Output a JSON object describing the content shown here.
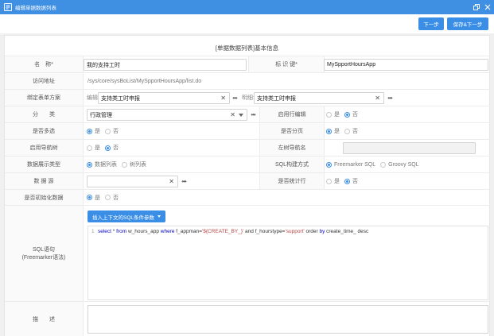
{
  "window": {
    "title": "编辑单据数据列表"
  },
  "toolbar": {
    "next_label": "下一步",
    "save_next_label": "保存&下一步"
  },
  "panel": {
    "title": "[单据数据列表]基本信息"
  },
  "form": {
    "name": {
      "label": "名　称*",
      "value": "我的支持工时"
    },
    "identifier": {
      "label": "标 识 键*",
      "value": "MySpportHoursApp"
    },
    "url": {
      "label": "访问地址",
      "value": "/sys/core/sysBoList/MySpportHoursApp/list.do"
    },
    "bind_form": {
      "label": "绑定表单方案",
      "edit_label": "编辑:",
      "edit_value": "支持类工时申报",
      "detail_label": "明细:",
      "detail_value": "支持类工时申报"
    },
    "category": {
      "label": "分　　类",
      "value": "行政管理"
    },
    "row_edit": {
      "label": "启用行编辑",
      "options": [
        "是",
        "否"
      ],
      "selected": "否"
    },
    "multi_select": {
      "label": "是否多选",
      "options": [
        "是",
        "否"
      ],
      "selected": "是"
    },
    "paging": {
      "label": "是否分页",
      "options": [
        "是",
        "否"
      ],
      "selected": "是"
    },
    "nav_tree": {
      "label": "启用导航树",
      "options": [
        "是",
        "否"
      ],
      "selected": "否"
    },
    "left_nav_name": {
      "label": "左树导航名",
      "value": ""
    },
    "display_type": {
      "label": "数据展示类型",
      "options": [
        "数据列表",
        "树列表"
      ],
      "selected": "数据列表"
    },
    "sql_build": {
      "label": "SQL构建方式",
      "options": [
        "Freemarker SQL",
        "Groovy SQL"
      ],
      "selected": "Freemarker SQL"
    },
    "datasource": {
      "label": "数 据 源",
      "value": ""
    },
    "stat_row": {
      "label": "是否统计行",
      "options": [
        "是",
        "否"
      ],
      "selected": "否"
    },
    "init_data": {
      "label": "是否初始化数据",
      "options": [
        "是",
        "否"
      ],
      "selected": "是"
    },
    "sql": {
      "label_line1": "SQL语句",
      "label_line2": "(Freemarker语法)",
      "insert_button": "插入上下文的SQL条件参数",
      "line_no": "1",
      "kw_select": "select",
      "part_star": " * ",
      "kw_from": "from",
      "part_table": " w_hours_app ",
      "kw_where": "where",
      "part_cond1": " f_appman=",
      "str_creator": "'${CREATE_BY_}'",
      "part_and": " and ",
      "part_cond2": "f_hourstype=",
      "str_support": "'support'",
      "part_order": " order ",
      "kw_by": "by",
      "part_tail": " create_time_ desc"
    },
    "description": {
      "label": "描　　述",
      "value": ""
    }
  },
  "colors": {
    "titlebar": "#3f8fe3",
    "primary": "#3a8ee6"
  }
}
